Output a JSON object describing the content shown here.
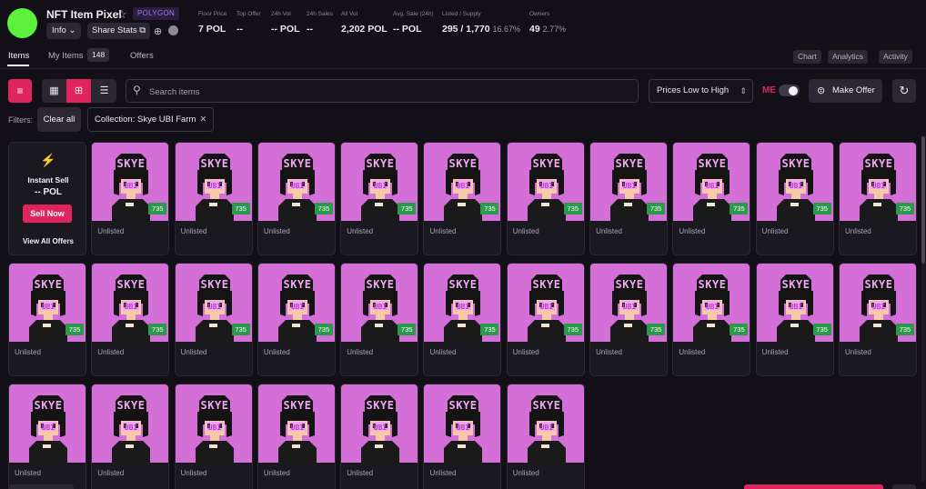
{
  "collection": {
    "name": "NFT Item Pixel",
    "chain": "POLYGON",
    "logo_color": "#5cf23c",
    "info_label": "Info",
    "share_label": "Share Stats"
  },
  "stats": [
    {
      "label": "Floor Price",
      "value": "7 POL",
      "sub": ""
    },
    {
      "label": "Top Offer",
      "value": "--",
      "sub": ""
    },
    {
      "label": "24h Vol",
      "value": "-- POL",
      "sub": ""
    },
    {
      "label": "24h Sales",
      "value": "--",
      "sub": ""
    },
    {
      "label": "All Vol",
      "value": "2,202 POL",
      "sub": ""
    },
    {
      "label": "Avg. Sale (24h)",
      "value": "-- POL",
      "sub": ""
    },
    {
      "label": "Listed / Supply",
      "value": "295 / 1,770",
      "sub": "16.67%"
    },
    {
      "label": "Owners",
      "value": "49",
      "sub": "2.77%"
    }
  ],
  "tabs": {
    "items": "Items",
    "my_items": "My Items",
    "my_items_count": "148",
    "offers": "Offers"
  },
  "right_tabs": {
    "chart": "Chart",
    "analytics": "Analytics",
    "activity": "Activity"
  },
  "toolbar": {
    "search_placeholder": "Search items",
    "sort_value": "Prices Low to High",
    "me_logo": "ME",
    "make_offer": "Make Offer"
  },
  "filters": {
    "label": "Filters:",
    "clear_all": "Clear all",
    "chip": "Collection: Skye UBI Farm"
  },
  "instant_sell": {
    "title": "Instant Sell",
    "price": "-- POL",
    "button": "Sell Now",
    "view_all": "View All Offers"
  },
  "colors": {
    "accent": "#e0245e",
    "price_tag": "#2c9a4c",
    "nft_bg": "#d56fd8"
  },
  "cards": [
    {
      "status": "Unlisted",
      "badge": "735"
    },
    {
      "status": "Unlisted",
      "badge": "735"
    },
    {
      "status": "Unlisted",
      "badge": "735"
    },
    {
      "status": "Unlisted",
      "badge": "735"
    },
    {
      "status": "Unlisted",
      "badge": "735"
    },
    {
      "status": "Unlisted",
      "badge": "735"
    },
    {
      "status": "Unlisted",
      "badge": "735"
    },
    {
      "status": "Unlisted",
      "badge": "735"
    },
    {
      "status": "Unlisted",
      "badge": "735"
    },
    {
      "status": "Unlisted",
      "badge": "735"
    },
    {
      "status": "Unlisted",
      "badge": "735"
    },
    {
      "status": "Unlisted",
      "badge": "735"
    },
    {
      "status": "Unlisted",
      "badge": "735"
    },
    {
      "status": "Unlisted",
      "badge": "735"
    },
    {
      "status": "Unlisted",
      "badge": "735"
    },
    {
      "status": "Unlisted",
      "badge": "735"
    },
    {
      "status": "Unlisted",
      "badge": "735"
    },
    {
      "status": "Unlisted",
      "badge": "735"
    },
    {
      "status": "Unlisted",
      "badge": "735"
    },
    {
      "status": "Unlisted",
      "badge": "735"
    },
    {
      "status": "Unlisted",
      "badge": "735"
    },
    {
      "status": "Unlisted",
      "badge": ""
    },
    {
      "status": "Unlisted",
      "badge": ""
    },
    {
      "status": "Unlisted",
      "badge": ""
    },
    {
      "status": "Unlisted",
      "badge": ""
    },
    {
      "status": "Unlisted",
      "badge": ""
    },
    {
      "status": "Unlisted",
      "badge": ""
    },
    {
      "status": "Unlisted",
      "badge": ""
    }
  ]
}
